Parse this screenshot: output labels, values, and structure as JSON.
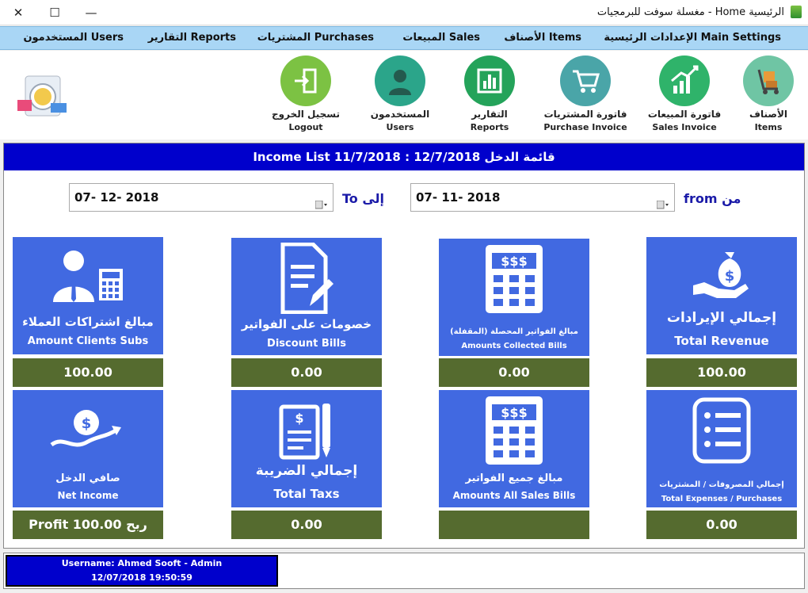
{
  "window": {
    "title": "الرئيسية Home - مغسلة سوفت للبرمجيات",
    "minimize": "—",
    "maximize": "☐",
    "close": "✕"
  },
  "menu": [
    {
      "label": "الإعدادات الرئيسية Main Settings"
    },
    {
      "label": "الأصناف Items"
    },
    {
      "label": "المبيعات Sales"
    },
    {
      "label": "المشتريات Purchases"
    },
    {
      "label": "التقارير Reports"
    },
    {
      "label": "المستخدمون Users"
    }
  ],
  "toolbar": [
    {
      "ar": "الأصناف",
      "en": "Items"
    },
    {
      "ar": "فاتورة المبيعات",
      "en": "Sales Invoice"
    },
    {
      "ar": "فاتورة المشتريات",
      "en": "Purchase Invoice"
    },
    {
      "ar": "التقارير",
      "en": "Reports"
    },
    {
      "ar": "المستخدمون",
      "en": "Users"
    },
    {
      "ar": "تسجيل الخروج",
      "en": "Logout"
    }
  ],
  "header": {
    "title": "Income List 11/7/2018 : 12/7/2018 قائمة الدخل"
  },
  "filters": {
    "from_label": "from من",
    "from_value": "07- 11- 2018",
    "to_label": "To إلى",
    "to_value": "07- 12- 2018"
  },
  "cards": [
    {
      "ar": "إجمالي الإيرادات",
      "en": "Total Revenue",
      "value": "100.00"
    },
    {
      "ar": "مبالغ الفواتير المحصلة (المقفلة)",
      "en": "Amounts Collected Bills",
      "value": "0.00"
    },
    {
      "ar": "خصومات على الفواتير",
      "en": "Discount Bills",
      "value": "0.00"
    },
    {
      "ar": "مبالغ اشتراكات العملاء",
      "en": "Amount Clients Subs",
      "value": "100.00"
    },
    {
      "ar": "إجمالي المصروفات / المشتريات",
      "en": "Total Expenses / Purchases",
      "value": "0.00"
    },
    {
      "ar": "مبالغ جميع الفواتير",
      "en": "Amounts All Sales Bills",
      "value": ""
    },
    {
      "ar": "إجمالي الضريبة",
      "en": "Total Taxs",
      "value": "0.00"
    },
    {
      "ar": "صافي الدخل",
      "en": "Net Income",
      "value": "Profit ربح 100.00"
    }
  ],
  "status": {
    "user": "Username: Ahmed Sooft - Admin",
    "datetime": "12/07/2018 19:50:59"
  },
  "colors": {
    "header_blue": "#0000cc",
    "card_blue": "#4169e1",
    "value_olive": "#556b2f",
    "menubar": "#a9d6f5"
  }
}
